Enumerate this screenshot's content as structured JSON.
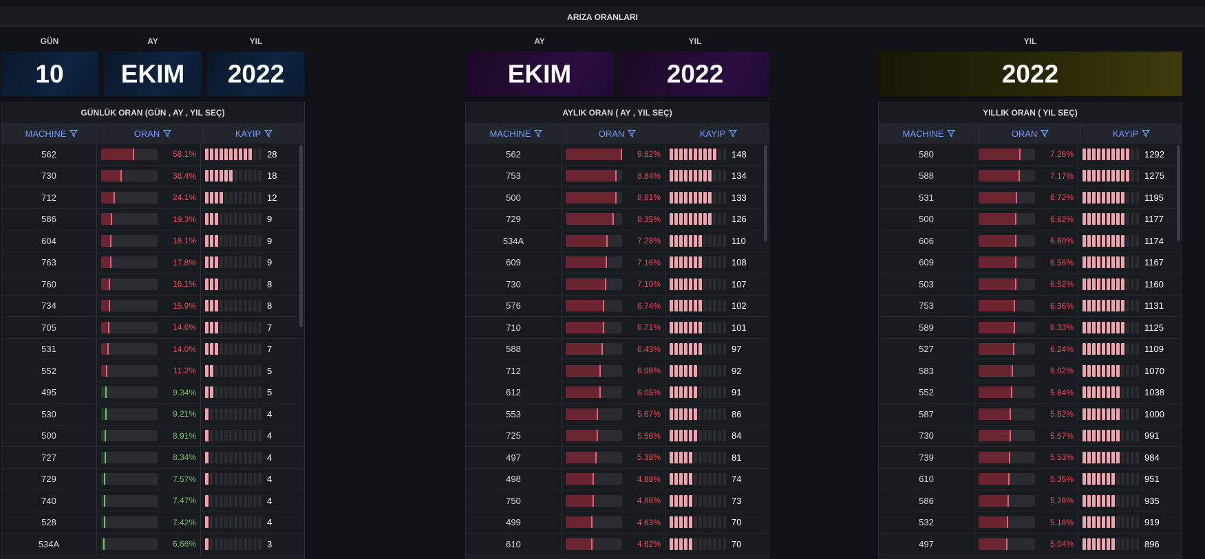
{
  "header": {
    "title": "ARIZA ORANLARI"
  },
  "daily": {
    "labels": {
      "day": "GÜN",
      "month": "AY",
      "year": "YIL"
    },
    "values": {
      "day": "10",
      "month": "EKIM",
      "year": "2022"
    },
    "title": "GÜNLÜK ORAN (GÜN , AY , YIL SEÇ)",
    "columns": [
      "MACHINE",
      "ORAN",
      "KAYIP"
    ],
    "rows": [
      {
        "machine": "562",
        "oran": "58.1%",
        "ratio": 0.581,
        "kayip": "28",
        "status": "red"
      },
      {
        "machine": "730",
        "oran": "36.4%",
        "ratio": 0.364,
        "kayip": "18",
        "status": "red"
      },
      {
        "machine": "712",
        "oran": "24.1%",
        "ratio": 0.241,
        "kayip": "12",
        "status": "red"
      },
      {
        "machine": "586",
        "oran": "19.3%",
        "ratio": 0.193,
        "kayip": "9",
        "status": "red"
      },
      {
        "machine": "604",
        "oran": "18.1%",
        "ratio": 0.181,
        "kayip": "9",
        "status": "red"
      },
      {
        "machine": "763",
        "oran": "17.8%",
        "ratio": 0.178,
        "kayip": "9",
        "status": "red"
      },
      {
        "machine": "760",
        "oran": "16.1%",
        "ratio": 0.161,
        "kayip": "8",
        "status": "red"
      },
      {
        "machine": "734",
        "oran": "15.9%",
        "ratio": 0.159,
        "kayip": "8",
        "status": "red"
      },
      {
        "machine": "705",
        "oran": "14.6%",
        "ratio": 0.146,
        "kayip": "7",
        "status": "red"
      },
      {
        "machine": "531",
        "oran": "14.0%",
        "ratio": 0.14,
        "kayip": "7",
        "status": "red"
      },
      {
        "machine": "552",
        "oran": "11.2%",
        "ratio": 0.112,
        "kayip": "5",
        "status": "red"
      },
      {
        "machine": "495",
        "oran": "9.34%",
        "ratio": 0.0934,
        "kayip": "5",
        "status": "green"
      },
      {
        "machine": "530",
        "oran": "9.21%",
        "ratio": 0.0921,
        "kayip": "4",
        "status": "green"
      },
      {
        "machine": "500",
        "oran": "8.91%",
        "ratio": 0.0891,
        "kayip": "4",
        "status": "green"
      },
      {
        "machine": "727",
        "oran": "8.34%",
        "ratio": 0.0834,
        "kayip": "4",
        "status": "green"
      },
      {
        "machine": "729",
        "oran": "7.57%",
        "ratio": 0.0757,
        "kayip": "4",
        "status": "green"
      },
      {
        "machine": "740",
        "oran": "7.47%",
        "ratio": 0.0747,
        "kayip": "4",
        "status": "green"
      },
      {
        "machine": "528",
        "oran": "7.42%",
        "ratio": 0.0742,
        "kayip": "4",
        "status": "green"
      },
      {
        "machine": "534A",
        "oran": "6.66%",
        "ratio": 0.0666,
        "kayip": "3",
        "status": "green"
      }
    ]
  },
  "monthly": {
    "labels": {
      "month": "AY",
      "year": "YIL"
    },
    "values": {
      "month": "EKIM",
      "year": "2022"
    },
    "title": "AYLIK ORAN ( AY , YIL SEÇ)",
    "columns": [
      "MACHINE",
      "ORAN",
      "KAYIP"
    ],
    "rows": [
      {
        "machine": "562",
        "oran": "9.82%",
        "ratio": 0.0982,
        "kayip": "148",
        "status": "red"
      },
      {
        "machine": "753",
        "oran": "8.84%",
        "ratio": 0.0884,
        "kayip": "134",
        "status": "red"
      },
      {
        "machine": "500",
        "oran": "8.81%",
        "ratio": 0.0881,
        "kayip": "133",
        "status": "red"
      },
      {
        "machine": "729",
        "oran": "8.35%",
        "ratio": 0.0835,
        "kayip": "126",
        "status": "red"
      },
      {
        "machine": "534A",
        "oran": "7.28%",
        "ratio": 0.0728,
        "kayip": "110",
        "status": "red"
      },
      {
        "machine": "609",
        "oran": "7.16%",
        "ratio": 0.0716,
        "kayip": "108",
        "status": "red"
      },
      {
        "machine": "730",
        "oran": "7.10%",
        "ratio": 0.071,
        "kayip": "107",
        "status": "red"
      },
      {
        "machine": "576",
        "oran": "6.74%",
        "ratio": 0.0674,
        "kayip": "102",
        "status": "red"
      },
      {
        "machine": "710",
        "oran": "6.71%",
        "ratio": 0.0671,
        "kayip": "101",
        "status": "red"
      },
      {
        "machine": "588",
        "oran": "6.43%",
        "ratio": 0.0643,
        "kayip": "97",
        "status": "red"
      },
      {
        "machine": "712",
        "oran": "6.08%",
        "ratio": 0.0608,
        "kayip": "92",
        "status": "red"
      },
      {
        "machine": "612",
        "oran": "6.05%",
        "ratio": 0.0605,
        "kayip": "91",
        "status": "red"
      },
      {
        "machine": "553",
        "oran": "5.67%",
        "ratio": 0.0567,
        "kayip": "86",
        "status": "red"
      },
      {
        "machine": "725",
        "oran": "5.56%",
        "ratio": 0.0556,
        "kayip": "84",
        "status": "red"
      },
      {
        "machine": "497",
        "oran": "5.38%",
        "ratio": 0.0538,
        "kayip": "81",
        "status": "red"
      },
      {
        "machine": "498",
        "oran": "4.88%",
        "ratio": 0.0488,
        "kayip": "74",
        "status": "red"
      },
      {
        "machine": "750",
        "oran": "4.86%",
        "ratio": 0.0486,
        "kayip": "73",
        "status": "red"
      },
      {
        "machine": "499",
        "oran": "4.63%",
        "ratio": 0.0463,
        "kayip": "70",
        "status": "red"
      },
      {
        "machine": "610",
        "oran": "4.62%",
        "ratio": 0.0462,
        "kayip": "70",
        "status": "red"
      }
    ]
  },
  "yearly": {
    "labels": {
      "year": "YIL"
    },
    "values": {
      "year": "2022"
    },
    "title": "YILLIK ORAN ( YIL SEÇ)",
    "columns": [
      "MACHINE",
      "ORAN",
      "KAYIP"
    ],
    "rows": [
      {
        "machine": "580",
        "oran": "7.26%",
        "ratio": 0.0726,
        "kayip": "1292",
        "status": "red"
      },
      {
        "machine": "588",
        "oran": "7.17%",
        "ratio": 0.0717,
        "kayip": "1275",
        "status": "red"
      },
      {
        "machine": "531",
        "oran": "6.72%",
        "ratio": 0.0672,
        "kayip": "1195",
        "status": "red"
      },
      {
        "machine": "500",
        "oran": "6.62%",
        "ratio": 0.0662,
        "kayip": "1177",
        "status": "red"
      },
      {
        "machine": "606",
        "oran": "6.60%",
        "ratio": 0.066,
        "kayip": "1174",
        "status": "red"
      },
      {
        "machine": "609",
        "oran": "6.56%",
        "ratio": 0.0656,
        "kayip": "1167",
        "status": "red"
      },
      {
        "machine": "503",
        "oran": "6.52%",
        "ratio": 0.0652,
        "kayip": "1160",
        "status": "red"
      },
      {
        "machine": "753",
        "oran": "6.36%",
        "ratio": 0.0636,
        "kayip": "1131",
        "status": "red"
      },
      {
        "machine": "589",
        "oran": "6.33%",
        "ratio": 0.0633,
        "kayip": "1125",
        "status": "red"
      },
      {
        "machine": "527",
        "oran": "6.24%",
        "ratio": 0.0624,
        "kayip": "1109",
        "status": "red"
      },
      {
        "machine": "583",
        "oran": "6.02%",
        "ratio": 0.0602,
        "kayip": "1070",
        "status": "red"
      },
      {
        "machine": "552",
        "oran": "5.84%",
        "ratio": 0.0584,
        "kayip": "1038",
        "status": "red"
      },
      {
        "machine": "587",
        "oran": "5.62%",
        "ratio": 0.0562,
        "kayip": "1000",
        "status": "red"
      },
      {
        "machine": "730",
        "oran": "5.57%",
        "ratio": 0.0557,
        "kayip": "991",
        "status": "red"
      },
      {
        "machine": "739",
        "oran": "5.53%",
        "ratio": 0.0553,
        "kayip": "984",
        "status": "red"
      },
      {
        "machine": "610",
        "oran": "5.35%",
        "ratio": 0.0535,
        "kayip": "951",
        "status": "red"
      },
      {
        "machine": "586",
        "oran": "5.26%",
        "ratio": 0.0526,
        "kayip": "935",
        "status": "red"
      },
      {
        "machine": "532",
        "oran": "5.16%",
        "ratio": 0.0516,
        "kayip": "919",
        "status": "red"
      },
      {
        "machine": "497",
        "oran": "5.04%",
        "ratio": 0.0504,
        "kayip": "896",
        "status": "red"
      }
    ]
  },
  "colors": {
    "bad": "#f2495c",
    "good": "#73bf69",
    "header_link": "#6e9fff",
    "lcd_on": "#f0a3ad"
  },
  "icons": {
    "column_filter": "filter-icon"
  }
}
